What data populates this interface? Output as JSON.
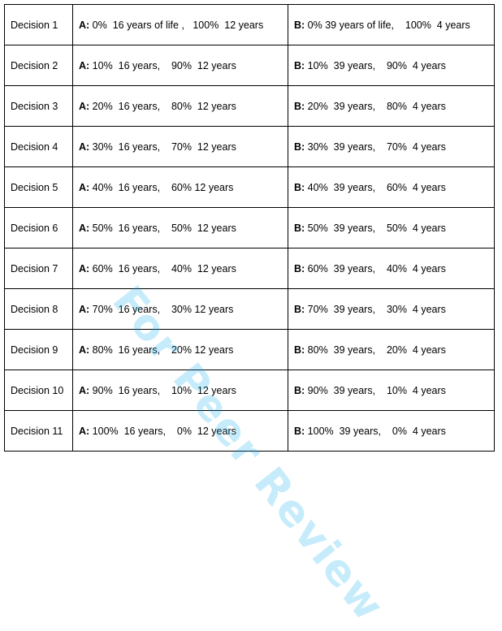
{
  "watermark": "For Peer Review",
  "colors": {
    "watermark": "#00aeef",
    "border": "#000000"
  },
  "rows": [
    {
      "label": "Decision 1",
      "a_letter": "A:",
      "a_text": " 0%  16 years of life ,   100%  12 years",
      "b_letter": "B:",
      "b_text": " 0% 39 years of life,    100%  4 years"
    },
    {
      "label": "Decision 2",
      "a_letter": "A:",
      "a_text": " 10%  16 years,    90%  12 years",
      "b_letter": "B:",
      "b_text": " 10%  39 years,    90%  4 years"
    },
    {
      "label": "Decision 3",
      "a_letter": "A:",
      "a_text": " 20%  16 years,    80%  12 years",
      "b_letter": "B:",
      "b_text": " 20%  39 years,    80%  4 years"
    },
    {
      "label": "Decision 4",
      "a_letter": "A:",
      "a_text": " 30%  16 years,    70%  12 years",
      "b_letter": "B:",
      "b_text": " 30%  39 years,    70%  4 years"
    },
    {
      "label": "Decision 5",
      "a_letter": "A:",
      "a_text": " 40%  16 years,    60% 12 years",
      "b_letter": "B:",
      "b_text": " 40%  39 years,    60%  4 years"
    },
    {
      "label": "Decision 6",
      "a_letter": "A:",
      "a_text": " 50%  16 years,    50%  12 years",
      "b_letter": "B:",
      "b_text": " 50%  39 years,    50%  4 years"
    },
    {
      "label": "Decision 7",
      "a_letter": "A:",
      "a_text": " 60%  16 years,    40%  12 years",
      "b_letter": "B:",
      "b_text": " 60%  39 years,    40%  4 years"
    },
    {
      "label": "Decision 8",
      "a_letter": "A:",
      "a_text": " 70%  16 years,    30% 12 years",
      "b_letter": "B:",
      "b_text": " 70%  39 years,    30%  4 years"
    },
    {
      "label": "Decision 9",
      "a_letter": "A:",
      "a_text": " 80%  16 years,    20% 12 years",
      "b_letter": "B:",
      "b_text": " 80%  39 years,    20%  4 years"
    },
    {
      "label": "Decision 10",
      "a_letter": "A:",
      "a_text": " 90%  16 years,    10%  12 years",
      "b_letter": "B:",
      "b_text": " 90%  39 years,    10%  4 years"
    },
    {
      "label": "Decision 11",
      "a_letter": "A:",
      "a_text": " 100%  16 years,    0%  12 years",
      "b_letter": "B:",
      "b_text": " 100%  39 years,    0%  4 years"
    }
  ]
}
